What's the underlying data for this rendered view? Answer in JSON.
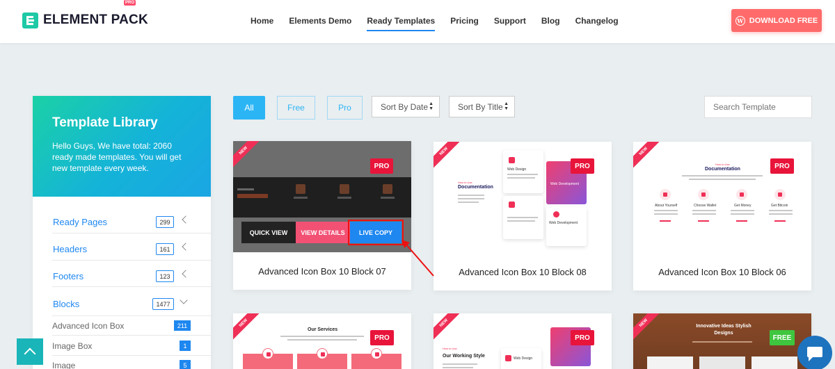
{
  "brand": {
    "name": "ELEMENT PACK",
    "badge": "PRO"
  },
  "nav": [
    "Home",
    "Elements Demo",
    "Ready Templates",
    "Pricing",
    "Support",
    "Blog",
    "Changelog"
  ],
  "nav_active": "Ready Templates",
  "download_label": "DOWNLOAD FREE",
  "sidebar": {
    "title": "Template Library",
    "intro": "Hello Guys, We have total: 2060 ready made templates. You will get new template every week.",
    "categories": [
      {
        "label": "Ready Pages",
        "count": "299"
      },
      {
        "label": "Headers",
        "count": "161"
      },
      {
        "label": "Footers",
        "count": "123"
      },
      {
        "label": "Blocks",
        "count": "1477"
      }
    ],
    "subcategories": [
      {
        "label": "Advanced Icon Box",
        "count": "211"
      },
      {
        "label": "Image Box",
        "count": "1"
      },
      {
        "label": "Image",
        "count": "5"
      }
    ]
  },
  "filters": {
    "all": "All",
    "free": "Free",
    "pro": "Pro",
    "sort_date": "Sort By Date",
    "sort_title": "Sort By Title",
    "search_placeholder": "Search Template"
  },
  "cards": [
    {
      "title": "Advanced Icon Box 10 Block 07",
      "badge": "PRO",
      "ribbon": "NEW"
    },
    {
      "title": "Advanced Icon Box 10 Block 08",
      "badge": "PRO",
      "ribbon": "NEW"
    },
    {
      "title": "Advanced Icon Box 10 Block 06",
      "badge": "PRO",
      "ribbon": "NEW"
    },
    {
      "title": "",
      "badge": "PRO",
      "ribbon": "NEW"
    },
    {
      "title": "",
      "badge": "PRO",
      "ribbon": "NEW"
    },
    {
      "title": "",
      "badge": "FREE",
      "ribbon": "NEW"
    }
  ],
  "hover_actions": {
    "quick_view": "QUICK VIEW",
    "view_details": "VIEW DETAILS",
    "live_copy": "LIVE COPY"
  },
  "thumb_text": {
    "documentation": "Documentation",
    "how_to_use": "How to Use",
    "web_design": "Web Design",
    "web_development": "Web Development",
    "about_yourself": "About Yourself",
    "choose_wallet": "Choose Wallet",
    "get_money": "Get Money",
    "get_bitcoin": "Get Bitcoin",
    "our_services": "Our Services",
    "our_working_style": "Our Working Style",
    "innovative": "Innovative Ideas Stylish Designs"
  },
  "colors": {
    "accent": "#1e87f0",
    "brand_teal": "#1ec9a6",
    "pro": "#e8143a",
    "free": "#3fc63f",
    "download": "#ff6b6b"
  }
}
